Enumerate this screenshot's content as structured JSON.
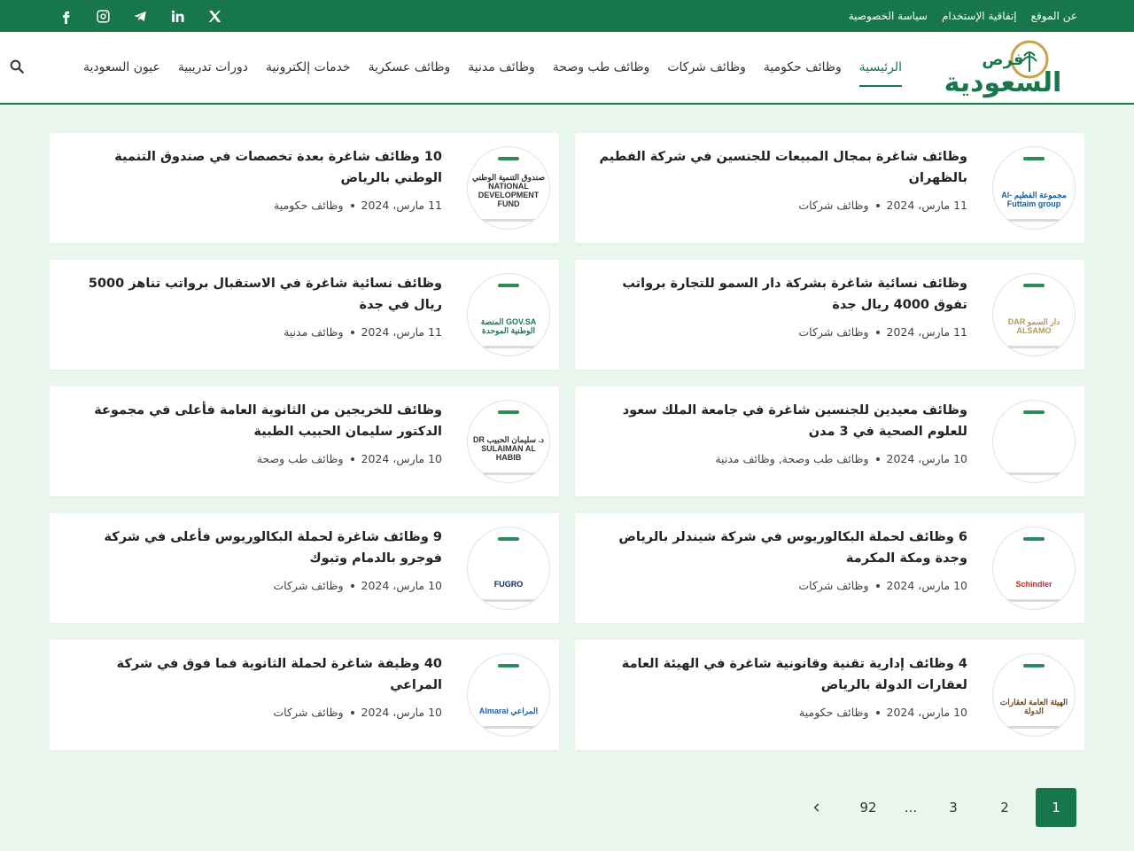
{
  "topbar": {
    "links": [
      "عن الموقع",
      "إتفاقية الإستخدام",
      "سياسة الخصوصية"
    ],
    "social": [
      "x-icon",
      "linkedin-icon",
      "telegram-icon",
      "instagram-icon",
      "facebook-icon"
    ]
  },
  "header": {
    "logo_text": "فرص السعودية",
    "nav": [
      "الرئيسية",
      "وظائف حكومية",
      "وظائف شركات",
      "وظائف طب وصحة",
      "وظائف مدنية",
      "وظائف عسكرية",
      "خدمات إلكترونية",
      "دورات تدريبية",
      "عيون السعودية"
    ]
  },
  "posts": [
    {
      "title": "وظائف شاغرة بمجال المبيعات للجنسين في شركة الفطيم بالظهران",
      "date": "11 مارس، 2024",
      "category": "وظائف شركات",
      "thumb_label": "مجموعة الفطيم Al-Futtaim group",
      "thumb_color": "#1f5b8c"
    },
    {
      "title": "10 وظائف شاغرة بعدة تخصصات في صندوق التنمية الوطني بالرياض",
      "date": "11 مارس، 2024",
      "category": "وظائف حكومية",
      "thumb_label": "صندوق التنمية الوطني NATIONAL DEVELOPMENT FUND",
      "thumb_color": "#333333"
    },
    {
      "title": "وظائف نسائية شاغرة بشركة دار السمو للتجارة برواتب تفوق 4000 ريال جدة",
      "date": "11 مارس، 2024",
      "category": "وظائف شركات",
      "thumb_label": "دار السمو DAR ALSAMO",
      "thumb_color": "#b59a55"
    },
    {
      "title": "وظائف نسائية شاغرة في الاستقبال برواتب تناهز 5000 ريال في جدة",
      "date": "11 مارس، 2024",
      "category": "وظائف مدنية",
      "thumb_label": "GOV.SA المنصة الوطنية الموحدة",
      "thumb_color": "#1a7a4c"
    },
    {
      "title": "وظائف معيدين للجنسين شاغرة في جامعة الملك سعود للعلوم الصحية في 3 مدن",
      "date": "10 مارس، 2024",
      "category": "وظائف طب وصحة, وظائف مدنية",
      "thumb_label": "",
      "thumb_color": "#2f7a3b"
    },
    {
      "title": "وظائف للخريجين من الثانوية العامة فأعلى في مجموعة الدكتور سليمان الحبيب الطبية",
      "date": "10 مارس، 2024",
      "category": "وظائف طب وصحة",
      "thumb_label": "د. سليمان الحبيب DR SULAIMAN AL HABIB",
      "thumb_color": "#333333"
    },
    {
      "title": "6 وظائف لحملة البكالوريوس في شركة شيندلر بالرياض وجدة ومكة المكرمة",
      "date": "10 مارس، 2024",
      "category": "وظائف شركات",
      "thumb_label": "Schindler",
      "thumb_color": "#c62828"
    },
    {
      "title": "9 وظائف شاغرة لحملة البكالوريوس فأعلى في شركة فوجرو بالدمام وتبوك",
      "date": "10 مارس، 2024",
      "category": "وظائف شركات",
      "thumb_label": "FUGRO",
      "thumb_color": "#0a2a5c"
    },
    {
      "title": "4 وظائف إدارية تقنية وقانونية شاغرة في الهيئة العامة لعقارات الدولة بالرياض",
      "date": "10 مارس، 2024",
      "category": "وظائف حكومية",
      "thumb_label": "الهيئة العامة لعقارات الدولة",
      "thumb_color": "#6b4a2a"
    },
    {
      "title": "40 وظيفة شاغرة لحملة الثانوية فما فوق في شركة المراعي",
      "date": "10 مارس، 2024",
      "category": "وظائف شركات",
      "thumb_label": "المراعي Almarai",
      "thumb_color": "#1f5fa8"
    }
  ],
  "pagination": [
    "1",
    "2",
    "3",
    "...",
    "92"
  ],
  "colors": {
    "brand": "#17764a",
    "background": "#e8f6ee"
  }
}
